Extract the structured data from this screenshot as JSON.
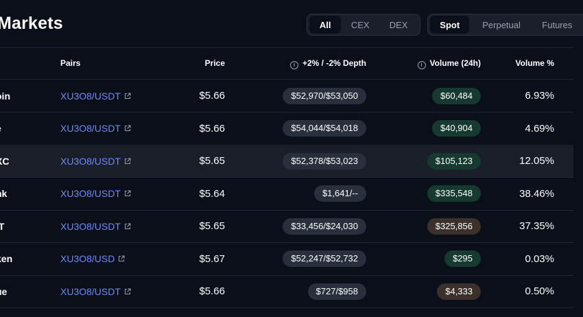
{
  "page": {
    "title": "Markets"
  },
  "filters": {
    "venue": {
      "options": [
        "All",
        "CEX",
        "DEX"
      ],
      "active": "All"
    },
    "market": {
      "options": [
        "Spot",
        "Perpetual",
        "Futures"
      ],
      "active": "Spot"
    }
  },
  "table": {
    "columns": {
      "pairs": "Pairs",
      "price": "Price",
      "depth": "+2% / -2% Depth",
      "volume": "Volume (24h)",
      "volume_pct": "Volume %"
    },
    "rows": [
      {
        "exchange": "oin",
        "pair": "XU3O8/USDT",
        "price": "$5.66",
        "depth": "$52,970/$53,050",
        "volume": "$60,484",
        "volume_tone": "green",
        "volume_pct": "6.93%"
      },
      {
        "exchange": "e",
        "pair": "XU3O8/USDT",
        "price": "$5.66",
        "depth": "$54,044/$54,018",
        "volume": "$40,904",
        "volume_tone": "green",
        "volume_pct": "4.69%"
      },
      {
        "exchange": "XC",
        "pair": "XU3O8/USDT",
        "price": "$5.65",
        "depth": "$52,378/$53,023",
        "volume": "$105,123",
        "volume_tone": "green",
        "volume_pct": "12.05%",
        "highlighted": true
      },
      {
        "exchange": "nk",
        "pair": "XU3O8/USDT",
        "price": "$5.64",
        "depth": "$1,641/--",
        "volume": "$335,548",
        "volume_tone": "green",
        "volume_pct": "38.46%"
      },
      {
        "exchange": "IT",
        "pair": "XU3O8/USDT",
        "price": "$5.65",
        "depth": "$33,456/$24,030",
        "volume": "$325,856",
        "volume_tone": "brown",
        "volume_pct": "37.35%"
      },
      {
        "exchange": "ken",
        "pair": "XU3O8/USD",
        "price": "$5.67",
        "depth": "$52,247/$52,732",
        "volume": "$295",
        "volume_tone": "green",
        "volume_pct": "0.03%"
      },
      {
        "exchange": "ue",
        "pair": "XU3O8/USDT",
        "price": "$5.66",
        "depth": "$727/$958",
        "volume": "$4,333",
        "volume_tone": "brown",
        "volume_pct": "0.50%"
      }
    ]
  },
  "icons": {
    "info": "info-circle-icon",
    "external_link": "external-link-icon"
  },
  "colors": {
    "background": "#0b0f19",
    "link": "#6b8cff",
    "pill_gray": "#2a2f3d",
    "pill_green": "#173a30",
    "pill_brown": "#3b302b"
  }
}
